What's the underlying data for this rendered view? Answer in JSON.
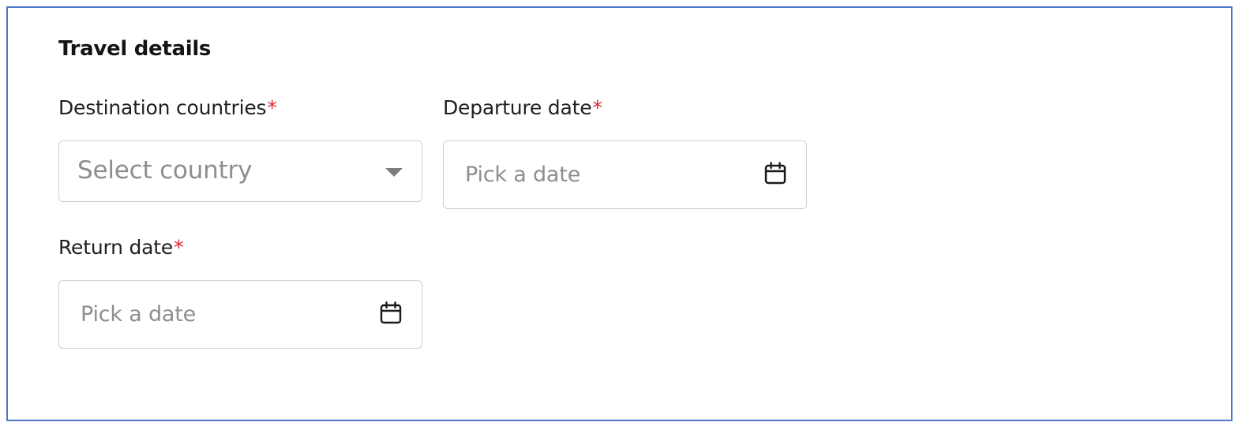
{
  "form": {
    "title": "Travel details",
    "required_marker": "*",
    "colors": {
      "border_accent": "#4a78c8",
      "required": "#d9262e",
      "placeholder": "#8e8e8e",
      "input_border": "#cfcfcf"
    },
    "destination": {
      "label": "Destination countries",
      "placeholder": "Select country",
      "icon": "dropdown-caret-icon"
    },
    "departure": {
      "label": "Departure date",
      "placeholder": "Pick a date",
      "icon": "calendar-icon"
    },
    "return": {
      "label": "Return date",
      "placeholder": "Pick a date",
      "icon": "calendar-icon"
    }
  }
}
